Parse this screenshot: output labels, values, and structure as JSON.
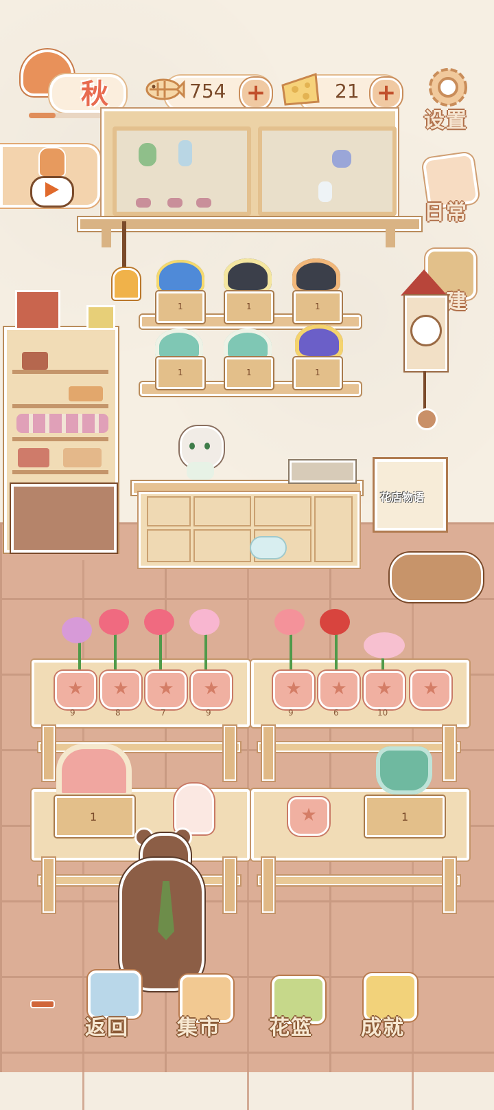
{
  "season": {
    "label": "秋",
    "progress": 0.3
  },
  "resources": {
    "fish": {
      "icon": "fish-bone-icon",
      "value": "754"
    },
    "cheese": {
      "icon": "cheese-icon",
      "value": "21"
    }
  },
  "side_menu": [
    {
      "label": "设置",
      "icon": "gear-icon"
    },
    {
      "label": "日常",
      "icon": "tip-note-icon"
    },
    {
      "label": "扩建",
      "icon": "hammer-icon"
    }
  ],
  "video": {
    "icon": "play-icon"
  },
  "shelf_crates": {
    "top": [
      "1",
      "1",
      "1"
    ],
    "bottom": [
      "1",
      "1",
      "1"
    ]
  },
  "sign": {
    "text": "花店物语"
  },
  "flower_tables": {
    "left_counts": [
      "9",
      "8",
      "7",
      "9"
    ],
    "right_counts": [
      "9",
      "6",
      "10"
    ]
  },
  "display_crates": {
    "left": "1",
    "right": "1"
  },
  "bottom_nav": [
    {
      "label": "返回",
      "icon": "window-icon"
    },
    {
      "label": "集市",
      "icon": "market-stall-icon"
    },
    {
      "label": "花篮",
      "icon": "flower-basket-icon"
    },
    {
      "label": "成就",
      "icon": "trophy-icon"
    }
  ],
  "colors": {
    "accent": "#e86b50",
    "wood": "#ecd2a6",
    "floor": "#dcae96"
  }
}
